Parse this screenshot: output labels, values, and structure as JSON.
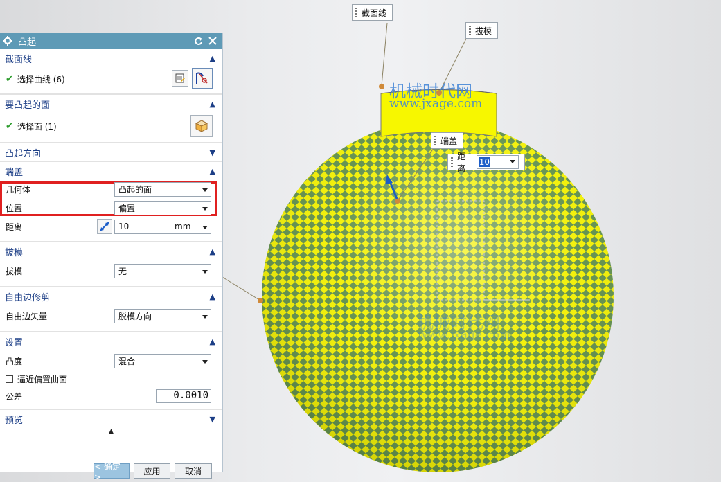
{
  "dialog": {
    "title": "凸起",
    "sections": {
      "section_curve": {
        "title": "截面线",
        "select_label": "选择曲线 (6)"
      },
      "face": {
        "title": "要凸起的面",
        "select_label": "选择面 (1)"
      },
      "direction": {
        "title": "凸起方向"
      },
      "cap": {
        "title": "端盖",
        "geometry_label": "几何体",
        "geometry_value": "凸起的面",
        "position_label": "位置",
        "position_value": "偏置",
        "distance_label": "距离",
        "distance_value": "10",
        "distance_unit": "mm"
      },
      "draft": {
        "title": "拔模",
        "draft_label": "拔模",
        "draft_value": "无"
      },
      "free_edge": {
        "title": "自由边修剪",
        "vector_label": "自由边矢量",
        "vector_value": "脱模方向"
      },
      "settings": {
        "title": "设置",
        "convexity_label": "凸度",
        "convexity_value": "混合",
        "approx_label": "逼近偏置曲面",
        "tolerance_label": "公差",
        "tolerance_value": "0.0010"
      },
      "preview": {
        "title": "预览"
      }
    },
    "buttons": {
      "ok": "< 确定 >",
      "apply": "应用",
      "cancel": "取消"
    }
  },
  "viewport": {
    "callouts": {
      "section": "截面线",
      "draft": "拔模",
      "cap": "端盖",
      "distance_label": "距离",
      "distance_value": "10"
    },
    "watermark": {
      "cn": "机械时代网",
      "url": "www.jxage.com"
    }
  },
  "colors": {
    "title_bar": "#5e9ab6",
    "section_header_text": "#1c3e86",
    "highlight_box": "#e02020",
    "sphere_yellow": "#f2f000",
    "sphere_green": "#5f8f4a"
  }
}
